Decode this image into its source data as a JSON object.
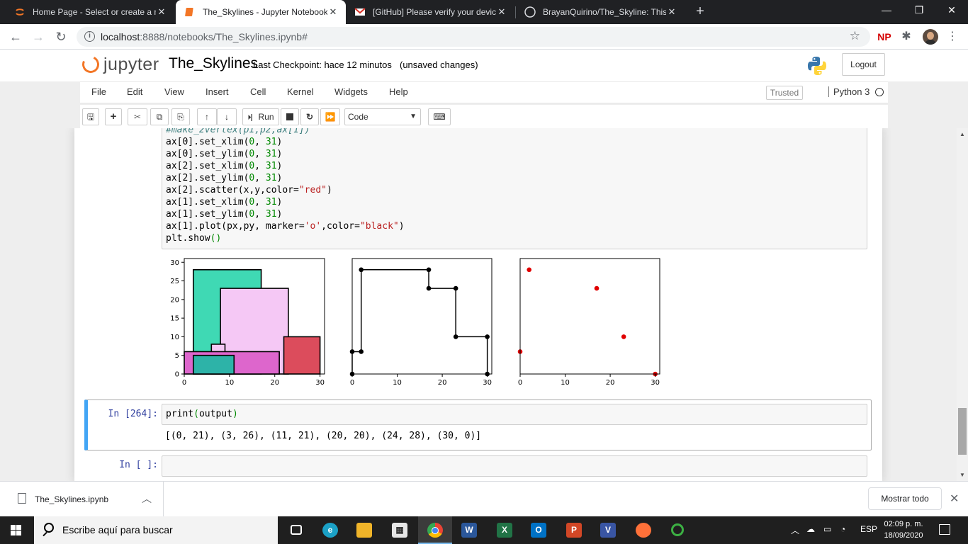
{
  "browser": {
    "tabs": [
      {
        "title": "Home Page - Select or create a n",
        "icon": "jupyter-icon"
      },
      {
        "title": "The_Skylines - Jupyter Notebook",
        "icon": "jupyter-notebook-icon",
        "active": true
      },
      {
        "title": "[GitHub] Please verify your devic",
        "icon": "gmail-icon"
      },
      {
        "title": "BrayanQuirino/The_Skyline: This",
        "icon": "github-icon"
      }
    ],
    "url_host": "localhost",
    "url_path": ":8888/notebooks/The_Skylines.ipynb#",
    "ext_label": "NP"
  },
  "jupyter": {
    "logo_text": "jupyter",
    "notebook_name": "The_Skylines",
    "checkpoint": "Last Checkpoint: hace 12 minutos",
    "unsaved": "(unsaved changes)",
    "logout": "Logout",
    "menu": [
      "File",
      "Edit",
      "View",
      "Insert",
      "Cell",
      "Kernel",
      "Widgets",
      "Help"
    ],
    "trusted": "Trusted",
    "kernel": "Python 3",
    "run_label": "Run",
    "cell_type": "Code"
  },
  "cells": {
    "code_partial_first_line": "#make_2vertex(p1,p2,ax[1])",
    "code_lines": [
      "ax[0].set_xlim(0, 31)",
      "ax[0].set_ylim(0, 31)",
      "ax[2].set_xlim(0, 31)",
      "ax[2].set_ylim(0, 31)",
      "ax[2].scatter(x,y,color=\"red\")",
      "ax[1].set_xlim(0, 31)",
      "ax[1].set_ylim(0, 31)",
      "ax[1].plot(px,py, marker='o',color=\"black\")",
      "plt.show()"
    ],
    "prompt_264": "In [264]:",
    "code_264": "print(output)",
    "output_264": "[(0, 21), (3, 26), (11, 21), (20, 20), (24, 28), (30, 0)]",
    "prompt_empty": "In [ ]:"
  },
  "chart_data": [
    {
      "type": "other",
      "description_kind": "rectangles",
      "xlim": [
        0,
        31
      ],
      "ylim": [
        0,
        31
      ],
      "xticks": [
        0,
        10,
        20,
        30
      ],
      "yticks": [
        0,
        5,
        10,
        15,
        20,
        25,
        30
      ],
      "rectangles": [
        {
          "x0": 2,
          "x1": 17,
          "y0": 0,
          "y1": 28,
          "fill": "#3fd9b4"
        },
        {
          "x0": 8,
          "x1": 23,
          "y0": 0,
          "y1": 23,
          "fill": "#f5c8f5"
        },
        {
          "x0": 22,
          "x1": 30,
          "y0": 0,
          "y1": 10,
          "fill": "#dc4c5c"
        },
        {
          "x0": 6,
          "x1": 9,
          "y0": 0,
          "y1": 8,
          "fill": "#f5c8f5"
        },
        {
          "x0": 0,
          "x1": 21,
          "y0": 0,
          "y1": 6,
          "fill": "#dd66cc"
        },
        {
          "x0": 2,
          "x1": 11,
          "y0": 0,
          "y1": 5,
          "fill": "#2db3a8"
        }
      ]
    },
    {
      "type": "line",
      "xlim": [
        0,
        31
      ],
      "ylim": [
        0,
        31
      ],
      "xticks": [
        0,
        10,
        20,
        30
      ],
      "color": "black",
      "points": [
        [
          0,
          0
        ],
        [
          0,
          6
        ],
        [
          2,
          6
        ],
        [
          2,
          28
        ],
        [
          17,
          28
        ],
        [
          17,
          23
        ],
        [
          23,
          23
        ],
        [
          23,
          10
        ],
        [
          30,
          10
        ],
        [
          30,
          0
        ]
      ]
    },
    {
      "type": "scatter",
      "xlim": [
        0,
        31
      ],
      "ylim": [
        0,
        31
      ],
      "xticks": [
        0,
        10,
        20,
        30
      ],
      "color": "red",
      "points": [
        [
          0,
          6
        ],
        [
          2,
          28
        ],
        [
          17,
          23
        ],
        [
          23,
          10
        ],
        [
          30,
          0
        ]
      ]
    }
  ],
  "downloads": {
    "file": "The_Skylines.ipynb",
    "show_all": "Mostrar todo"
  },
  "taskbar": {
    "search_placeholder": "Escribe aquí para buscar",
    "lang": "ESP",
    "time": "02:09 p. m.",
    "date": "18/09/2020"
  }
}
